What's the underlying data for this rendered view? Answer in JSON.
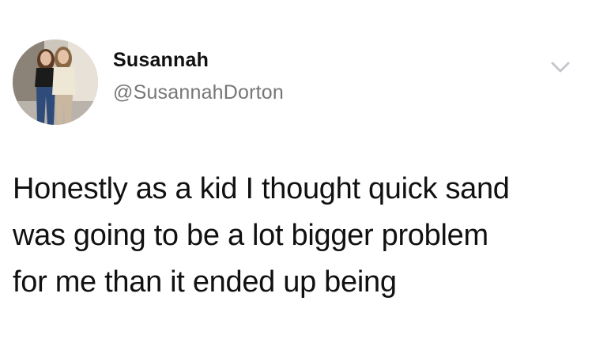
{
  "tweet": {
    "display_name": "Susannah",
    "handle": "@SusannahDorton",
    "text_lines": [
      "Honestly as a kid I thought quick sand",
      "was going to be a lot bigger problem",
      "for me than it ended up being"
    ]
  },
  "icons": {
    "avatar": "profile-photo",
    "menu": "chevron-down-icon"
  },
  "colors": {
    "text": "#111111",
    "handle": "#777777",
    "chevron": "#c4c8cc",
    "background": "#ffffff"
  }
}
